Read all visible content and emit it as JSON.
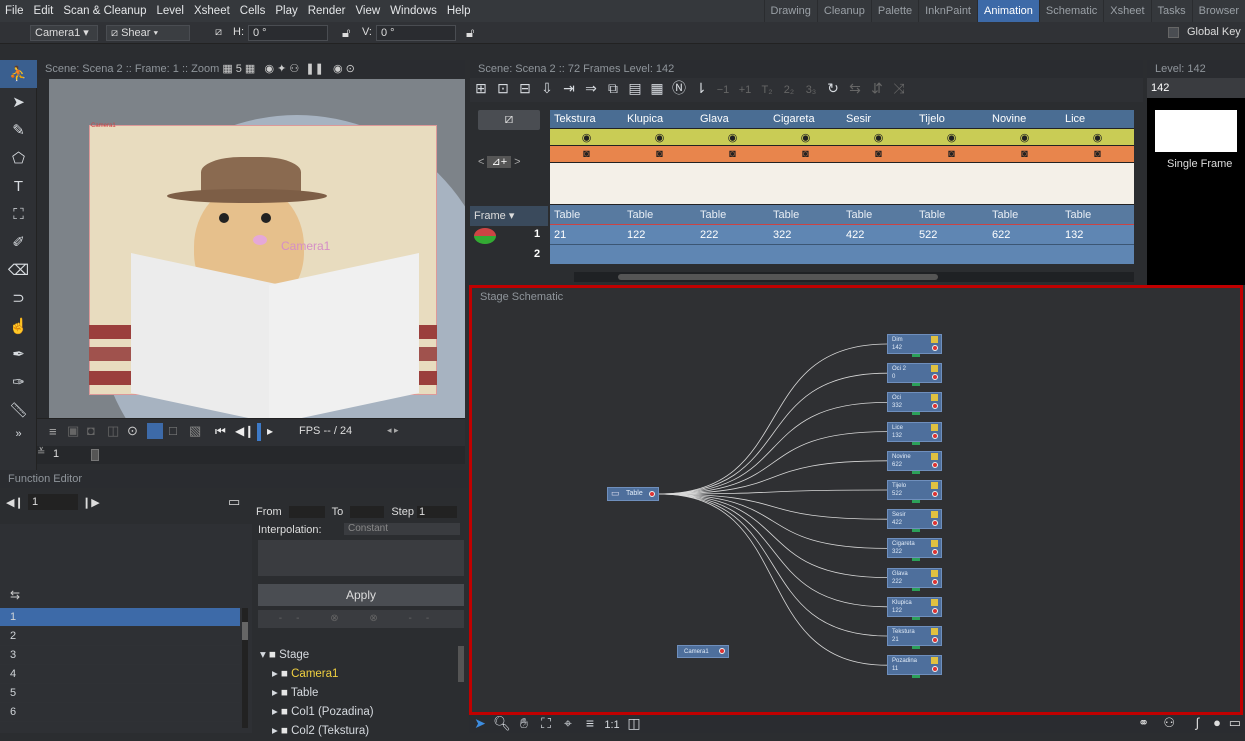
{
  "menu": [
    "File",
    "Edit",
    "Scan & Cleanup",
    "Level",
    "Xsheet",
    "Cells",
    "Play",
    "Render",
    "View",
    "Windows",
    "Help"
  ],
  "rooms": [
    "Drawing",
    "Cleanup",
    "Palette",
    "InknPaint",
    "Animation",
    "Schematic",
    "Xsheet",
    "Tasks",
    "Browser"
  ],
  "active_room": "Animation",
  "tool_options": {
    "object": "Camera1",
    "mode": "Shear",
    "h_label": "H:",
    "h_value": "0 °",
    "v_label": "V:",
    "v_value": "0 °",
    "global_key": "Global Key"
  },
  "viewer": {
    "title": "Scene: Scena 2  ::  Frame: 1  ::  Zoom",
    "camera_label": "Camera1",
    "fps": "FPS -- / 24",
    "frame": "1",
    "cam_overlay": "Camera1"
  },
  "xsheet": {
    "title": "Scene: Scena 2  ::  72 Frames  Level: 142",
    "frame_label": "Frame",
    "columns": [
      {
        "name": "Tekstura",
        "pegbar": "Table",
        "cell1": "21"
      },
      {
        "name": "Klupica",
        "pegbar": "Table",
        "cell1": "122"
      },
      {
        "name": "Glava",
        "pegbar": "Table",
        "cell1": "222"
      },
      {
        "name": "Cigareta",
        "pegbar": "Table",
        "cell1": "322"
      },
      {
        "name": "Sesir",
        "pegbar": "Table",
        "cell1": "422"
      },
      {
        "name": "Tijelo",
        "pegbar": "Table",
        "cell1": "522"
      },
      {
        "name": "Novine",
        "pegbar": "Table",
        "cell1": "622"
      },
      {
        "name": "Lice",
        "pegbar": "Table",
        "cell1": "132"
      }
    ],
    "rows": [
      "1",
      "2"
    ]
  },
  "level_strip": {
    "title": "Level: 142",
    "level": "142",
    "frame_label": "Single Frame"
  },
  "schematic": {
    "title": "Stage Schematic",
    "table_node": "Table",
    "camera_node": "Camera1",
    "nodes": [
      {
        "name": "Dim",
        "num": "142"
      },
      {
        "name": "Oci 2",
        "num": "0"
      },
      {
        "name": "Oci",
        "num": "332"
      },
      {
        "name": "Lice",
        "num": "132"
      },
      {
        "name": "Novine",
        "num": "622"
      },
      {
        "name": "Tijelo",
        "num": "522"
      },
      {
        "name": "Sesir",
        "num": "422"
      },
      {
        "name": "Cigareta",
        "num": "322"
      },
      {
        "name": "Glava",
        "num": "222"
      },
      {
        "name": "Klupica",
        "num": "122"
      },
      {
        "name": "Tekstura",
        "num": "21"
      },
      {
        "name": "Pozadina",
        "num": "11"
      }
    ],
    "zoom_label": "1:1"
  },
  "function_editor": {
    "title": "Function Editor",
    "frame": "1",
    "from": "From",
    "to": "To",
    "step": "Step",
    "step_value": "1",
    "interpolation": "Interpolation:",
    "interp_value": "Constant",
    "apply": "Apply",
    "rows": [
      "1",
      "2",
      "3",
      "4",
      "5",
      "6"
    ],
    "tree": [
      {
        "label": "Stage",
        "level": 0,
        "highlight": false
      },
      {
        "label": "Camera1",
        "level": 1,
        "highlight": true
      },
      {
        "label": "Table",
        "level": 1,
        "highlight": false
      },
      {
        "label": "Col1 (Pozadina)",
        "level": 1,
        "highlight": false
      },
      {
        "label": "Col2 (Tekstura)",
        "level": 1,
        "highlight": false
      }
    ]
  }
}
